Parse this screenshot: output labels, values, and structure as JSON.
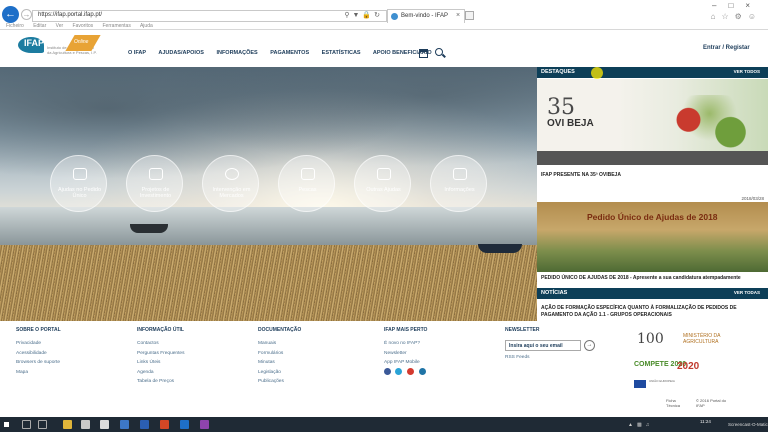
{
  "browser": {
    "url": "https://ifap.portal.ifap.pt/",
    "tab_title": "Bem-vindo - IFAP",
    "menu": [
      "Ficheiro",
      "Editar",
      "Ver",
      "Favoritos",
      "Ferramentas",
      "Ajuda"
    ]
  },
  "site": {
    "logo": "IFAP",
    "logo_subtitle": "Instituto de Financiamento da Agricultura e Pescas, I.P.",
    "logo_band": "Online",
    "nav": [
      "O IFAP",
      "AJUDAS/APOIOS",
      "INFORMAÇÕES",
      "PAGAMENTOS",
      "ESTATÍSTICAS",
      "APOIO BENEFICIÁRIO"
    ],
    "login": "Entrar / Registar"
  },
  "hero": {
    "items": [
      "Ajudas no Pedido Único",
      "Projetos de Investimento",
      "Intervenção em Mercados",
      "Pescas",
      "Outras Ajudas",
      "Informações"
    ]
  },
  "destaques": {
    "title": "DESTAQUES",
    "view_all": "VER TODOS",
    "image_num": "35",
    "image_word": "OVI BEJA",
    "item1_title": "IFAP PRESENTE NA 35ª OVIBEJA",
    "item1_date": "2018/03/28",
    "item2_image_title": "Pedido Único de Ajudas de 2018",
    "item2_title": "PEDIDO ÚNICO DE AJUDAS DE 2018 - Apresente a sua candidatura atempadamente"
  },
  "noticias": {
    "title": "NOTÍCIAS",
    "view_all": "VER TODAS",
    "item1_title": "AÇÃO DE FORMAÇÃO ESPECÍFICA QUANTO À FORMALIZAÇÃO DE PEDIDOS DE PAGAMENTO DA AÇÃO 1.1 - GRUPOS OPERACIONAIS"
  },
  "footer": {
    "sobre": {
      "title": "SOBRE O PORTAL",
      "items": [
        "Privacidade",
        "Acessibilidade",
        "Browsers de suporte",
        "Mapa"
      ]
    },
    "info": {
      "title": "INFORMAÇÃO ÚTIL",
      "items": [
        "Contactos",
        "Perguntas Frequentes",
        "Links Úteis",
        "Agenda",
        "Tabela de Preços"
      ]
    },
    "doc": {
      "title": "DOCUMENTAÇÃO",
      "items": [
        "Manuais",
        "Formulários",
        "Minutas",
        "Legislação",
        "Publicações"
      ]
    },
    "perto": {
      "title": "IFAP MAIS PERTO",
      "items": [
        "É novo no IFAP?",
        "Newsletter",
        "App IFAP Mobile"
      ]
    },
    "newsletter": {
      "title": "NEWSLETTER",
      "placeholder": "Insira aqui o seu email",
      "rss": "RSS Feeds"
    },
    "logo_100": "100",
    "minag": "MINISTÉRIO DA AGRICULTURA",
    "compete": "COMPETE 2020",
    "pt2020": "2020",
    "eu": "UNIÃO EUROPEIA",
    "ficha": "Ficha Técnica",
    "copyright": "© 2016 Portal do IFAP"
  },
  "taskbar": {
    "time": "11:24",
    "brand": "Screencast-O-Matic"
  },
  "colors": {
    "header_dark": "#0d3f58",
    "nav_text": "#1d3c5a",
    "logo_blue": "#1c7ca0",
    "logo_orange": "#e8a335"
  }
}
